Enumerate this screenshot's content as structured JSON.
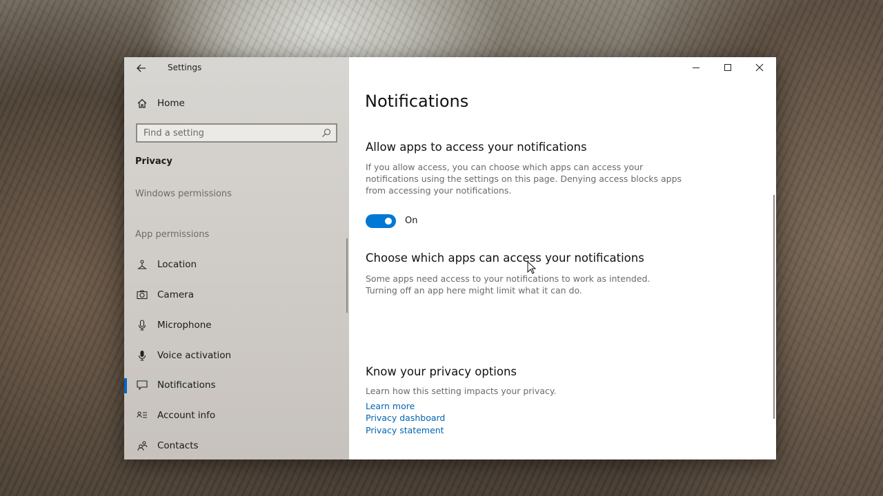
{
  "window": {
    "app_title": "Settings"
  },
  "sidebar": {
    "home_label": "Home",
    "search_placeholder": "Find a setting",
    "section_title": "Privacy",
    "windows_permissions_label": "Windows permissions",
    "app_permissions_label": "App permissions",
    "items": [
      {
        "label": "Location",
        "icon": "location-icon"
      },
      {
        "label": "Camera",
        "icon": "camera-icon"
      },
      {
        "label": "Microphone",
        "icon": "microphone-icon"
      },
      {
        "label": "Voice activation",
        "icon": "voice-activation-icon"
      },
      {
        "label": "Notifications",
        "icon": "notifications-icon",
        "active": true
      },
      {
        "label": "Account info",
        "icon": "account-info-icon"
      },
      {
        "label": "Contacts",
        "icon": "contacts-icon"
      }
    ]
  },
  "content": {
    "page_title": "Notifications",
    "allow_heading": "Allow apps to access your notifications",
    "allow_description": "If you allow access, you can choose which apps can access your notifications using the settings on this page. Denying access blocks apps from accessing your notifications.",
    "toggle_state_label": "On",
    "toggle_on": true,
    "choose_heading": "Choose which apps can access your notifications",
    "choose_description": "Some apps need access to your notifications to work as intended. Turning off an app here might limit what it can do.",
    "privacy_heading": "Know your privacy options",
    "privacy_description": "Learn how this setting impacts your privacy.",
    "links": {
      "learn_more": "Learn more",
      "privacy_dashboard": "Privacy dashboard",
      "privacy_statement": "Privacy statement"
    }
  },
  "colors": {
    "accent": "#0078d4",
    "link": "#0063b1",
    "sidebar_bg": "#d8d6d2"
  }
}
